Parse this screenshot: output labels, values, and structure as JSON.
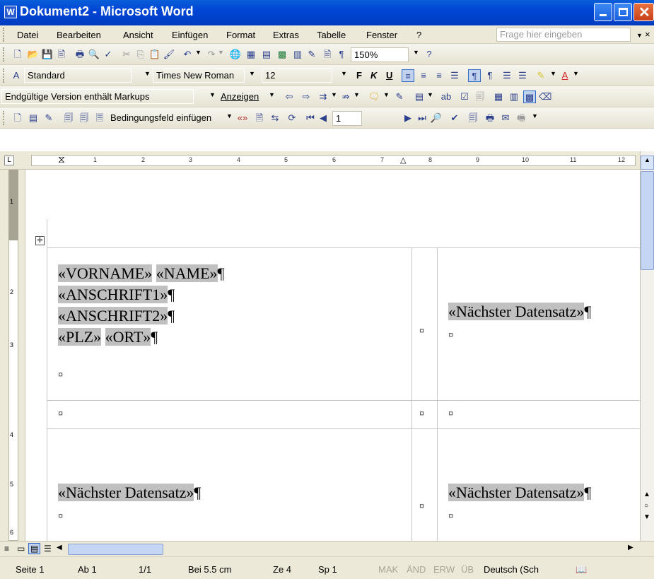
{
  "window": {
    "title": "Dokument2 - Microsoft Word",
    "app_icon": "W"
  },
  "menu": {
    "items": [
      "Datei",
      "Bearbeiten",
      "Ansicht",
      "Einfügen",
      "Format",
      "Extras",
      "Tabelle",
      "Fenster",
      "?"
    ],
    "help_placeholder": "Frage hier eingeben",
    "close_x": "×"
  },
  "standard_toolbar": {
    "zoom": "150%"
  },
  "format_toolbar": {
    "style": "Standard",
    "font": "Times New Roman",
    "size": "12",
    "bold": "F",
    "italic": "K",
    "underline": "U"
  },
  "review_toolbar": {
    "markup": "Endgültige Version enthält Markups",
    "show": "Anzeigen"
  },
  "mailmerge_toolbar": {
    "insert_field": "Bedingungsfeld einfügen",
    "record": "1"
  },
  "ruler": {
    "ticks": [
      "1",
      "2",
      "3",
      "4",
      "5",
      "6",
      "7",
      "8",
      "9",
      "10",
      "11",
      "12"
    ],
    "left_ticks": [
      "1",
      "2",
      "3",
      "4",
      "5",
      "6"
    ]
  },
  "document": {
    "cell1": {
      "vorname": "«VORNAME»",
      "name": "«NAME»",
      "anschrift1": "«ANSCHRIFT1»",
      "anschrift2": "«ANSCHRIFT2»",
      "plz": "«PLZ»",
      "ort": "«ORT»"
    },
    "next_record": "«Nächster Datensatz»",
    "pilcrow": "¶",
    "cell_mark": "¤"
  },
  "status": {
    "page": "Seite 1",
    "section": "Ab 1",
    "pages": "1/1",
    "position": "Bei 5.5 cm",
    "line": "Ze 4",
    "column": "Sp 1",
    "mak": "MAK",
    "and": "ÄND",
    "erw": "ERW",
    "ub": "ÜB",
    "language": "Deutsch (Sch"
  }
}
